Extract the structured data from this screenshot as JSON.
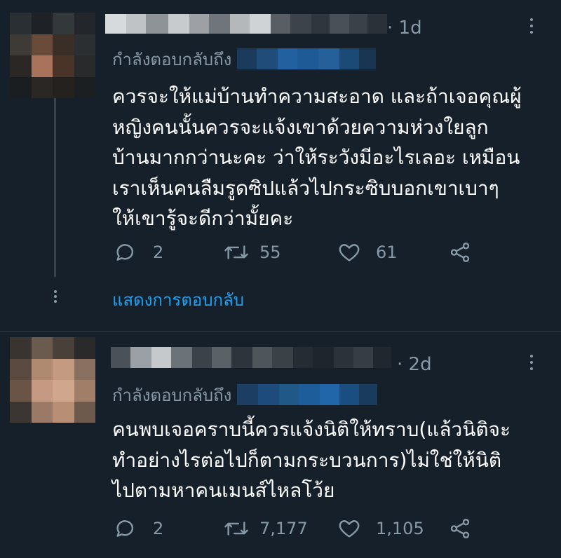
{
  "tweets": [
    {
      "time": "· 1d",
      "reply_label": "กำลังตอบกลับถึง",
      "body": "ควรจะให้แม่บ้านทำความสะอาด และถ้าเจอคุณผู้\nหญิงคนนั้นควรจะแจ้งเขาด้วยความห่วงใยลูก\nบ้านมากกว่านะคะ ว่าให้ระวังมีอะไรเลอะ เหมือน\nเราเห็นคนลืมรูดซิปแล้วไปกระซิบบอกเขาเบาๆ\nให้เขารู้จะดีกว่ามั้ยคะ",
      "actions": {
        "replies": "2",
        "retweets": "55",
        "likes": "61"
      },
      "show_replies": "แสดงการตอบกลับ",
      "icons": {
        "reply": "reply-bubble-icon",
        "retweet": "retweet-icon",
        "like": "heart-icon",
        "share": "share-icon",
        "more": "more-vertical-icon"
      }
    },
    {
      "time": "· 2d",
      "reply_label": "กำลังตอบกลับถึง",
      "body": "คนพบเจอคราบนี้ควรแจ้งนิติให้ทราบ(แล้วนิติจะ\nทำอย่างไรต่อไปก็ตามกระบวนการ)ไม่ใช่ให้นิติ\nไปตามหาคนเมนส์ไหลโว้ย",
      "actions": {
        "replies": "2",
        "retweets": "7,177",
        "likes": "1,105"
      },
      "icons": {
        "reply": "reply-bubble-icon",
        "retweet": "retweet-icon",
        "like": "heart-icon",
        "share": "share-icon",
        "more": "more-vertical-icon"
      }
    }
  ],
  "colors": {
    "background": "#15202b",
    "secondary_text": "#8899a6",
    "link": "#1da1f2",
    "divider": "#2f3b47"
  }
}
